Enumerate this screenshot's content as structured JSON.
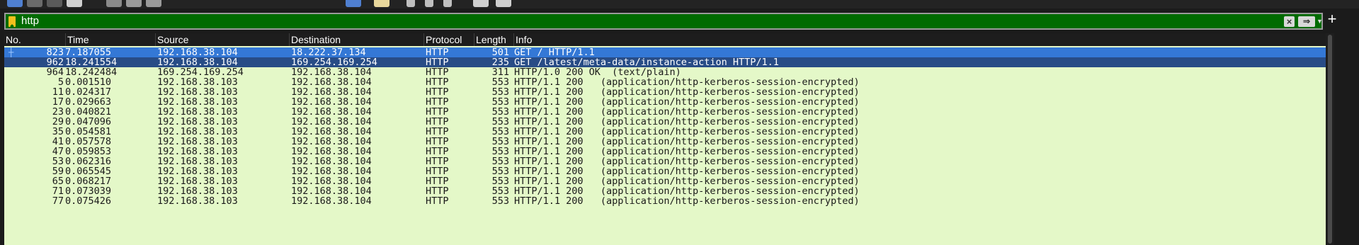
{
  "filter": {
    "value": "http"
  },
  "table": {
    "headers": {
      "no": "No.",
      "time": "Time",
      "source": "Source",
      "destination": "Destination",
      "protocol": "Protocol",
      "length": "Length",
      "info": "Info"
    },
    "rows": [
      {
        "no": "823",
        "time": "7.187055",
        "source": "192.168.38.104",
        "destination": "18.222.37.134",
        "protocol": "HTTP",
        "length": "501",
        "info": "GET / HTTP/1.1",
        "state": "selected"
      },
      {
        "no": "962",
        "time": "18.241554",
        "source": "192.168.38.104",
        "destination": "169.254.169.254",
        "protocol": "HTTP",
        "length": "235",
        "info": "GET /latest/meta-data/instance-action HTTP/1.1",
        "state": "related"
      },
      {
        "no": "964",
        "time": "18.242484",
        "source": "169.254.169.254",
        "destination": "192.168.38.104",
        "protocol": "HTTP",
        "length": "311",
        "info": "HTTP/1.0 200 OK  (text/plain)",
        "state": "normal"
      },
      {
        "no": "5",
        "time": "0.001510",
        "source": "192.168.38.103",
        "destination": "192.168.38.104",
        "protocol": "HTTP",
        "length": "553",
        "info": "HTTP/1.1 200   (application/http-kerberos-session-encrypted)",
        "state": "normal"
      },
      {
        "no": "11",
        "time": "0.024317",
        "source": "192.168.38.103",
        "destination": "192.168.38.104",
        "protocol": "HTTP",
        "length": "553",
        "info": "HTTP/1.1 200   (application/http-kerberos-session-encrypted)",
        "state": "normal"
      },
      {
        "no": "17",
        "time": "0.029663",
        "source": "192.168.38.103",
        "destination": "192.168.38.104",
        "protocol": "HTTP",
        "length": "553",
        "info": "HTTP/1.1 200   (application/http-kerberos-session-encrypted)",
        "state": "normal"
      },
      {
        "no": "23",
        "time": "0.040821",
        "source": "192.168.38.103",
        "destination": "192.168.38.104",
        "protocol": "HTTP",
        "length": "553",
        "info": "HTTP/1.1 200   (application/http-kerberos-session-encrypted)",
        "state": "normal"
      },
      {
        "no": "29",
        "time": "0.047096",
        "source": "192.168.38.103",
        "destination": "192.168.38.104",
        "protocol": "HTTP",
        "length": "553",
        "info": "HTTP/1.1 200   (application/http-kerberos-session-encrypted)",
        "state": "normal"
      },
      {
        "no": "35",
        "time": "0.054581",
        "source": "192.168.38.103",
        "destination": "192.168.38.104",
        "protocol": "HTTP",
        "length": "553",
        "info": "HTTP/1.1 200   (application/http-kerberos-session-encrypted)",
        "state": "normal"
      },
      {
        "no": "41",
        "time": "0.057578",
        "source": "192.168.38.103",
        "destination": "192.168.38.104",
        "protocol": "HTTP",
        "length": "553",
        "info": "HTTP/1.1 200   (application/http-kerberos-session-encrypted)",
        "state": "normal"
      },
      {
        "no": "47",
        "time": "0.059853",
        "source": "192.168.38.103",
        "destination": "192.168.38.104",
        "protocol": "HTTP",
        "length": "553",
        "info": "HTTP/1.1 200   (application/http-kerberos-session-encrypted)",
        "state": "normal"
      },
      {
        "no": "53",
        "time": "0.062316",
        "source": "192.168.38.103",
        "destination": "192.168.38.104",
        "protocol": "HTTP",
        "length": "553",
        "info": "HTTP/1.1 200   (application/http-kerberos-session-encrypted)",
        "state": "normal"
      },
      {
        "no": "59",
        "time": "0.065545",
        "source": "192.168.38.103",
        "destination": "192.168.38.104",
        "protocol": "HTTP",
        "length": "553",
        "info": "HTTP/1.1 200   (application/http-kerberos-session-encrypted)",
        "state": "normal"
      },
      {
        "no": "65",
        "time": "0.068217",
        "source": "192.168.38.103",
        "destination": "192.168.38.104",
        "protocol": "HTTP",
        "length": "553",
        "info": "HTTP/1.1 200   (application/http-kerberos-session-encrypted)",
        "state": "normal"
      },
      {
        "no": "71",
        "time": "0.073039",
        "source": "192.168.38.103",
        "destination": "192.168.38.104",
        "protocol": "HTTP",
        "length": "553",
        "info": "HTTP/1.1 200   (application/http-kerberos-session-encrypted)",
        "state": "normal"
      },
      {
        "no": "77",
        "time": "0.075426",
        "source": "192.168.38.103",
        "destination": "192.168.38.104",
        "protocol": "HTTP",
        "length": "553",
        "info": "HTTP/1.1 200   (application/http-kerberos-session-encrypted)",
        "state": "normal"
      }
    ]
  },
  "colors": {
    "filter_valid_bg": "#006b00",
    "row_bg": "#e4f8c8",
    "selected_bg": "#3478d6",
    "related_bg": "#284c86"
  },
  "icons": [
    "toolbar-icons",
    "bookmark-icon",
    "clear-filter-icon",
    "apply-filter-icon",
    "filter-dropdown-icon",
    "add-filter-button-icon",
    "related-packet-icon"
  ]
}
